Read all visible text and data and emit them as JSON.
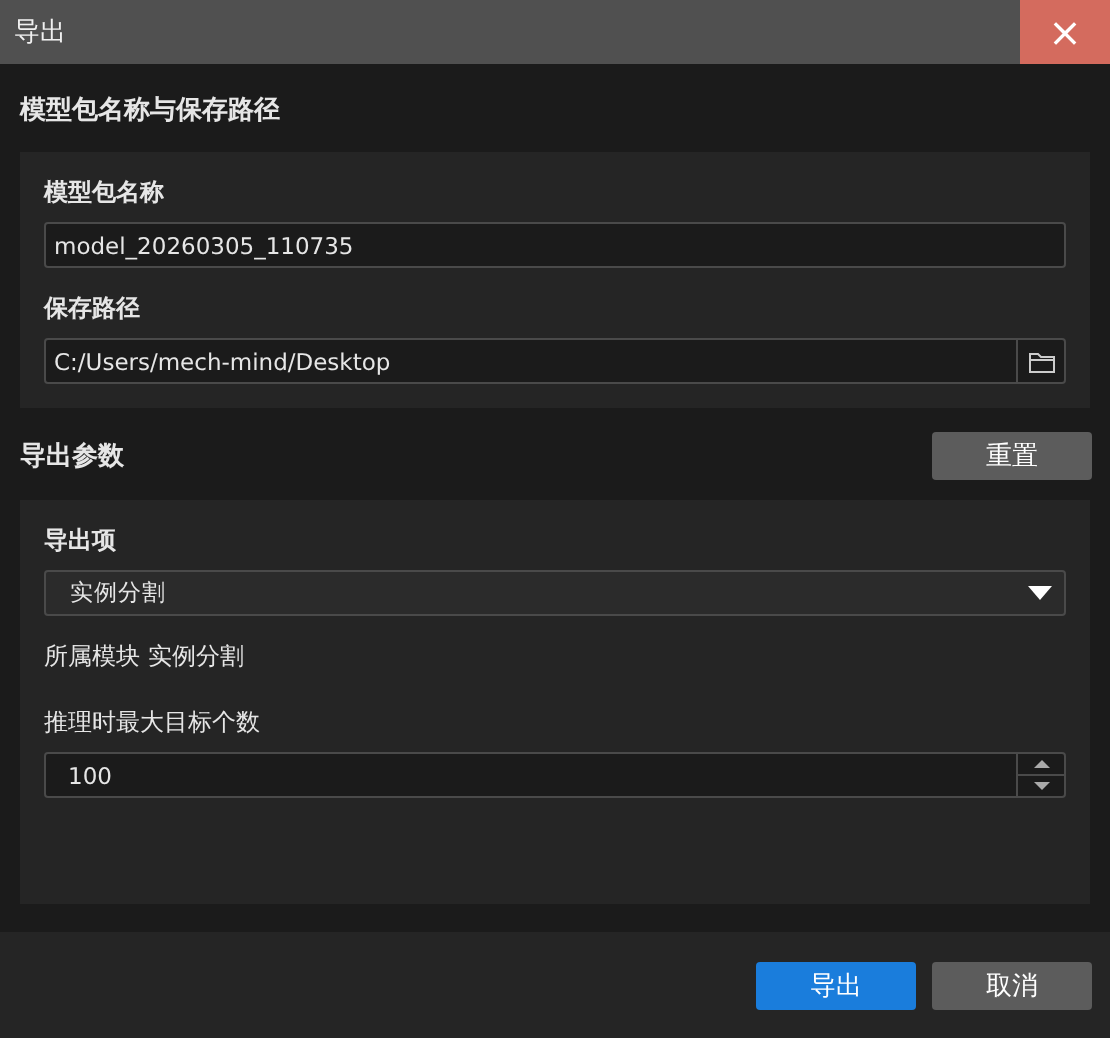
{
  "window": {
    "title": "导出",
    "close": "×"
  },
  "name_section": {
    "title": "模型包名称与保存路径",
    "name_field": {
      "label": "模型包名称",
      "value": "model_20260305_110735"
    },
    "path_field": {
      "label": "保存路径",
      "value": "C:/Users/mech-mind/Desktop"
    }
  },
  "params_section": {
    "title": "导出参数",
    "reset_button": "重置",
    "export_item": {
      "label": "导出项",
      "value": "实例分割"
    },
    "module": {
      "label": "所属模块",
      "value": "实例分割"
    },
    "max_targets": {
      "label": "推理时最大目标个数",
      "value": "100"
    }
  },
  "buttons": [
    {
      "label": "导出",
      "kind": "primary"
    },
    {
      "label": "取消",
      "kind": "secondary"
    }
  ]
}
